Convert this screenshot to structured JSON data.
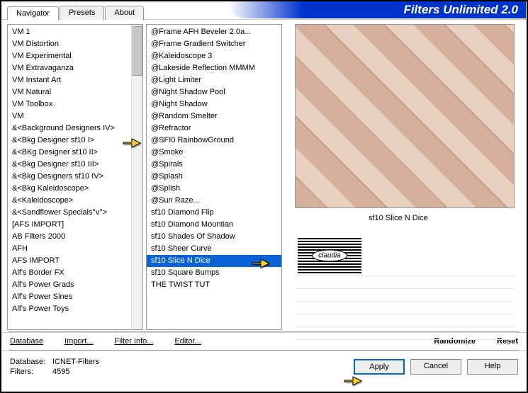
{
  "title": "Filters Unlimited 2.0",
  "tabs": {
    "navigator": "Navigator",
    "presets": "Presets",
    "about": "About"
  },
  "categories": [
    "VM 1",
    "VM Distortion",
    "VM Experimental",
    "VM Extravaganza",
    "VM Instant Art",
    "VM Natural",
    "VM Toolbox",
    "VM",
    "&<Background Designers IV>",
    "&<Bkg Designer sf10 I>",
    "&<BKg Designer sf10 II>",
    "&<Bkg Designer sf10 III>",
    "&<Bkg Designers sf10 IV>",
    "&<Bkg Kaleidoscope>",
    "&<Kaleidoscope>",
    "&<Sandflower Specials°v°>",
    "[AFS IMPORT]",
    "AB Filters 2000",
    "AFH",
    "AFS IMPORT",
    "Alf's Border FX",
    "Alf's Power Grads",
    "Alf's Power Sines",
    "Alf's Power Toys"
  ],
  "selected_category_index": 8,
  "filters": [
    "@Frame AFH Beveler 2.0a...",
    "@Frame Gradient Switcher",
    "@Kaleidoscope 3",
    "@Lakeside Reflection MMMM",
    "@Light Limiter",
    "@Night Shadow Pool",
    "@Night Shadow",
    "@Random Smelter",
    "@Refractor",
    "@SFI0 RainbowGround",
    "@Smoke",
    "@Spirals",
    "@Splash",
    "@Splish",
    "@Sun Raze...",
    "sf10 Diamond Flip",
    "sf10 Diamond Mountian",
    "sf10 Shades Of Shadow",
    "sf10 Sheer Curve",
    "sf10 Slice N Dice",
    "sf10 Square Bumps",
    "THE TWIST TUT"
  ],
  "selected_filter_index": 19,
  "current_filter": "sf10 Slice N Dice",
  "toolbar": {
    "database": "Database",
    "import": "Import...",
    "filterinfo": "Filter Info...",
    "editor": "Editor...",
    "randomize": "Randomize",
    "reset": "Reset"
  },
  "status": {
    "db_label": "Database:",
    "db_value": "ICNET-Filters",
    "filters_label": "Filters:",
    "filters_value": "4595"
  },
  "buttons": {
    "apply": "Apply",
    "cancel": "Cancel",
    "help": "Help"
  },
  "logo_text": "claudia"
}
